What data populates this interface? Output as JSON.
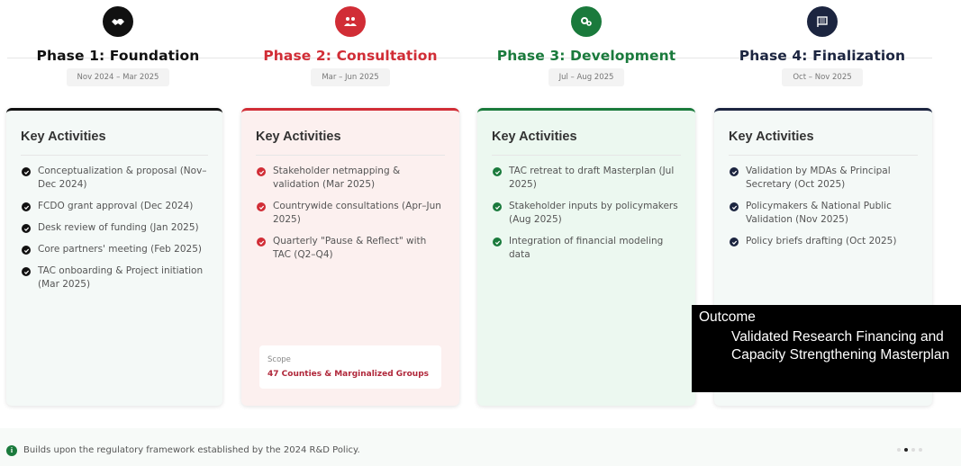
{
  "phases": [
    {
      "title": "Phase 1: Foundation",
      "dates": "Nov 2024 – Mar 2025",
      "icon": "handshake-icon",
      "accent": "#111111",
      "bg": "#f4f9f7"
    },
    {
      "title": "Phase 2: Consultation",
      "dates": "Mar – Jun 2025",
      "icon": "people-icon",
      "accent": "#d12d36",
      "bg": "#fcf0ef"
    },
    {
      "title": "Phase 3: Development",
      "dates": "Jul – Aug 2025",
      "icon": "gears-icon",
      "accent": "#1a7a3c",
      "bg": "#ecf8f0"
    },
    {
      "title": "Phase 4: Finalization",
      "dates": "Oct – Nov 2025",
      "icon": "flag-icon",
      "accent": "#1c2540",
      "bg": "#f4f9f7"
    }
  ],
  "cards": [
    {
      "heading": "Key Activities",
      "items": [
        "Conceptualization & proposal (Nov–Dec 2024)",
        "FCDO grant approval (Dec 2024)",
        "Desk review of funding (Jan 2025)",
        "Core partners' meeting (Feb 2025)",
        "TAC onboarding & Project initiation (Mar 2025)"
      ]
    },
    {
      "heading": "Key Activities",
      "items": [
        "Stakeholder netmapping & validation (Mar 2025)",
        "Countrywide consultations (Apr–Jun 2025)",
        "Quarterly \"Pause & Reflect\" with TAC (Q2–Q4)"
      ],
      "scope_label": "Scope",
      "scope_value": "47 Counties & Marginalized Groups"
    },
    {
      "heading": "Key Activities",
      "items": [
        "TAC retreat to draft Masterplan (Jul 2025)",
        "Stakeholder inputs by policymakers (Aug 2025)",
        "Integration of financial modeling data"
      ]
    },
    {
      "heading": "Key Activities",
      "items": [
        "Validation by MDAs & Principal Secretary (Oct 2025)",
        "Policymakers & National Public Validation (Nov 2025)",
        "Policy briefs drafting (Oct 2025)"
      ]
    }
  ],
  "outcome": {
    "label": "Outcome",
    "text": "Validated Research Financing and Capacity Strengthening Masterplan"
  },
  "footer": {
    "note": "Builds upon the regulatory framework established by the 2024 R&D Policy.",
    "info_icon": "info-icon",
    "page_dots": 4,
    "active_dot": 2
  }
}
